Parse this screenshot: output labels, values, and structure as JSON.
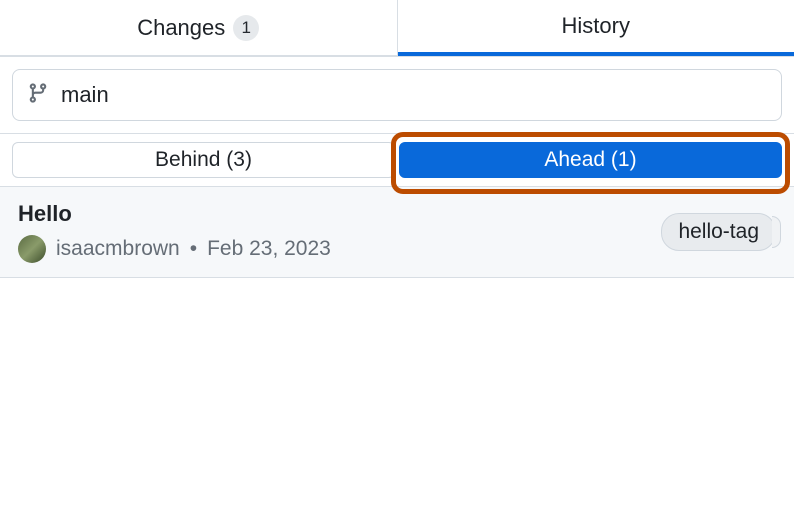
{
  "tabs": {
    "changes": {
      "label": "Changes",
      "badge": "1"
    },
    "history": {
      "label": "History"
    }
  },
  "branch": {
    "name": "main"
  },
  "compare": {
    "behind": {
      "label": "Behind (3)"
    },
    "ahead": {
      "label": "Ahead (1)"
    }
  },
  "commits": [
    {
      "title": "Hello",
      "author": "isaacmbrown",
      "separator": "•",
      "date": "Feb 23, 2023",
      "tag": "hello-tag"
    }
  ],
  "colors": {
    "accent": "#0969da",
    "highlight": "#bc4c00"
  }
}
